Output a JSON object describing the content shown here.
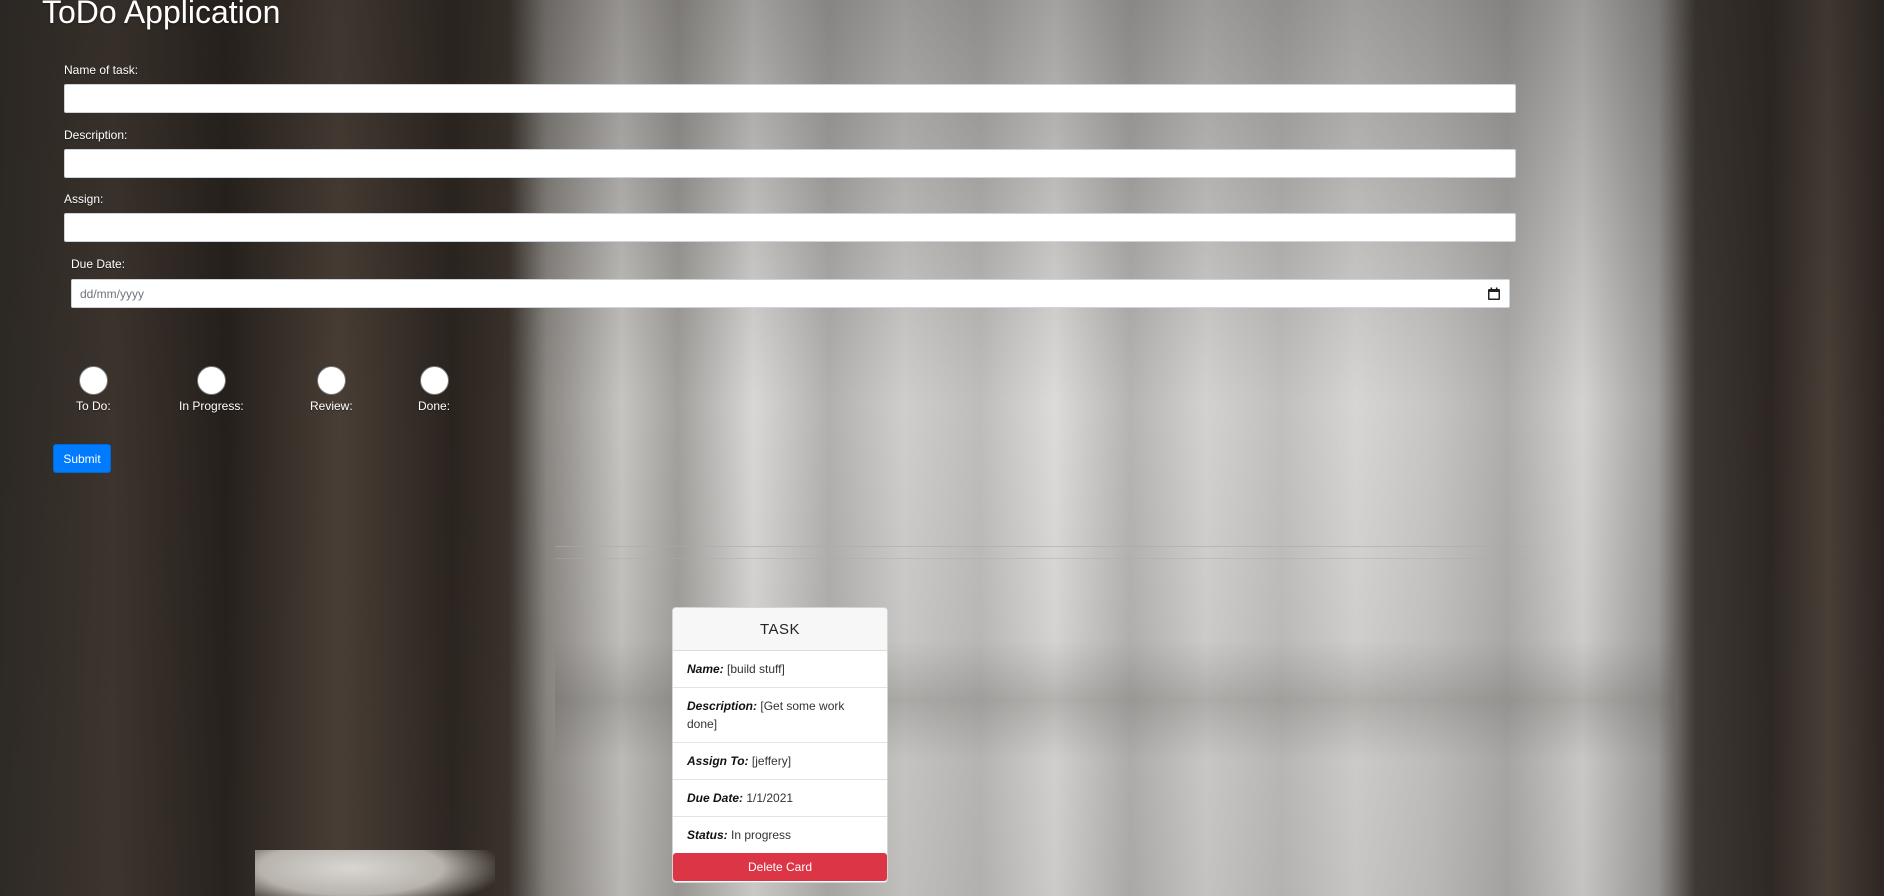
{
  "app": {
    "title": "ToDo Application"
  },
  "form": {
    "name_label": "Name of task:",
    "name_value": "",
    "description_label": "Description:",
    "description_value": "",
    "assign_label": "Assign:",
    "assign_value": "",
    "due_date_label": "Due Date:",
    "due_date_placeholder": "dd/mm/yyyy",
    "status_options": [
      {
        "label": "To Do:"
      },
      {
        "label": "In Progress:"
      },
      {
        "label": "Review:"
      },
      {
        "label": "Done:"
      }
    ],
    "submit_label": "Submit"
  },
  "card": {
    "header": "TASK",
    "name_key": "Name:",
    "name_value": "[build stuff]",
    "description_key": "Description:",
    "description_value": "[Get some work done]",
    "assign_key": "Assign To:",
    "assign_value": "[jeffery]",
    "due_key": "Due Date:",
    "due_value": "1/1/2021",
    "status_key": "Status:",
    "status_value": "In progress",
    "delete_label": "Delete Card"
  },
  "colors": {
    "primary": "#007bff",
    "danger": "#dc3545"
  },
  "icons": {
    "date_picker": "calendar-icon"
  }
}
